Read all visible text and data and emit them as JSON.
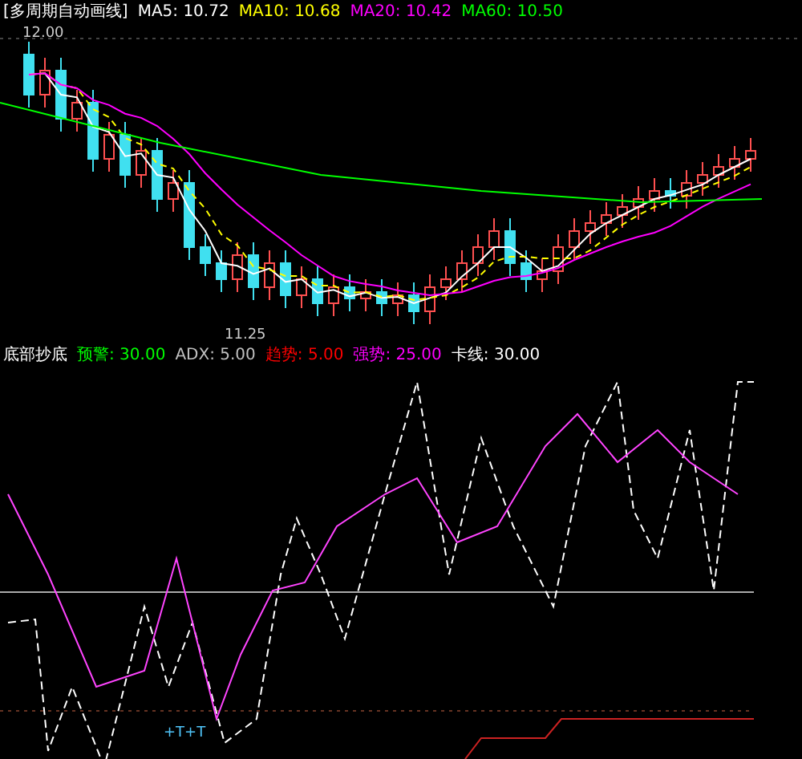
{
  "price_panel": {
    "title": "[多周期自动画线]",
    "indicators": [
      {
        "label": "MA5: 10.72",
        "color": "#ffffff"
      },
      {
        "label": "MA10: 10.68",
        "color": "#ffff00"
      },
      {
        "label": "MA20: 10.42",
        "color": "#ff00ff"
      },
      {
        "label": "MA60: 10.50",
        "color": "#00ff00"
      }
    ],
    "price_label": "12.00",
    "low_label": "11.25"
  },
  "indicator_panel": {
    "title": "底部抄底",
    "items": [
      {
        "label": "预警: 30.00",
        "color": "#00ff00"
      },
      {
        "label": "ADX: 5.00",
        "color": "#c0c0c0"
      },
      {
        "label": "趋势: 5.00",
        "color": "#ff0000"
      },
      {
        "label": "强势: 25.00",
        "color": "#ff00ff"
      },
      {
        "label": "卡线: 30.00",
        "color": "#ffffff"
      }
    ],
    "signal_text": "+T+T"
  }
}
